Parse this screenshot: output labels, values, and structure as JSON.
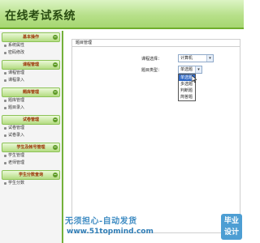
{
  "app": {
    "title": "在线考试系统"
  },
  "sidebar": {
    "groups": [
      {
        "title": "基本操作",
        "items": [
          "系统属性",
          "密码修改"
        ]
      },
      {
        "title": "课程管理",
        "items": [
          "课程管理",
          "课程录入"
        ]
      },
      {
        "title": "题库管理",
        "items": [
          "题库管理",
          "题目录入"
        ]
      },
      {
        "title": "试卷管理",
        "items": [
          "试卷管理",
          "试卷录入"
        ]
      },
      {
        "title": "学生及帐号管理",
        "items": [
          "学生管理",
          "老师管理"
        ]
      },
      {
        "title": "学生分数查询",
        "items": [
          "学生分数"
        ]
      }
    ]
  },
  "main": {
    "panel_title": "题目管理",
    "course_label": "课程选择：",
    "course_value": "计算机",
    "type_label": "题目类型：",
    "type_value": "单选题",
    "type_options": [
      "单选题",
      "多选题",
      "判断题",
      "简答题"
    ],
    "selected_option_index": 0
  },
  "watermark": {
    "line1": "无须担心-自动发货",
    "line2": "www.51topmind.com",
    "badge": "毕业设计"
  },
  "colors": {
    "header_green": "#b7e08a",
    "sidebar_border": "#74b13a",
    "group_text": "#9a2e00",
    "highlight": "#316ac5",
    "watermark_blue": "#3f8cc3"
  }
}
